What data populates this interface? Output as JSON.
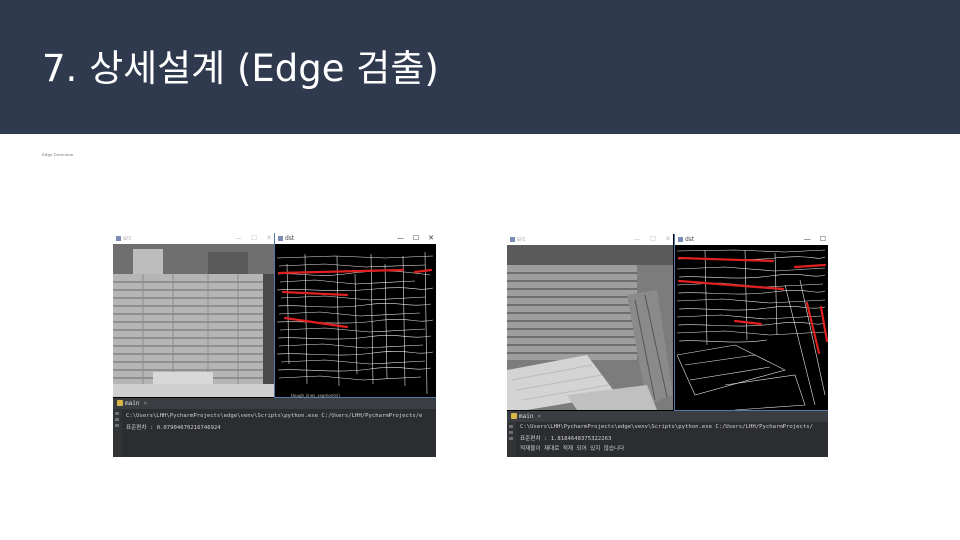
{
  "slide": {
    "title": "7. 상세설계 (Edge 검출)",
    "subtitle": "Edge Detection",
    "colors": {
      "header_bg": "#2f3a4f",
      "title_text": "#ffffff",
      "edge_line": "#e02020"
    }
  },
  "screenshots": [
    {
      "windows": [
        {
          "title": "src",
          "state": "inactive",
          "controls": [
            "—",
            "☐",
            "✕"
          ]
        },
        {
          "title": "dst",
          "state": "active",
          "controls": [
            "—",
            "☐",
            "✕"
          ],
          "caption": "Hough_lines_segments()"
        }
      ],
      "terminal": {
        "tab_label": "main",
        "tab_close": "×",
        "lines": [
          "C:\\Users\\LHH\\PycharmProjects\\edge\\venv\\Scripts\\python.exe C:/Users/LHH/PycharmProjects/e",
          "표준편차 :  0.07904670216746924"
        ]
      }
    },
    {
      "windows": [
        {
          "title": "src",
          "state": "inactive",
          "controls": [
            "—",
            "☐",
            "✕"
          ]
        },
        {
          "title": "dst",
          "state": "active",
          "controls": [
            "—",
            "☐"
          ]
        }
      ],
      "terminal": {
        "tab_label": "main",
        "tab_close": "×",
        "lines": [
          "C:\\Users\\LHH\\PycharmProjects\\edge\\venv\\Scripts\\python.exe C:/Users/LHH/PycharmProjects/",
          "표준편차 :  1.8184648375322263",
          "적재물이 제대로 적재 되어 있지 않습니다"
        ]
      }
    }
  ]
}
